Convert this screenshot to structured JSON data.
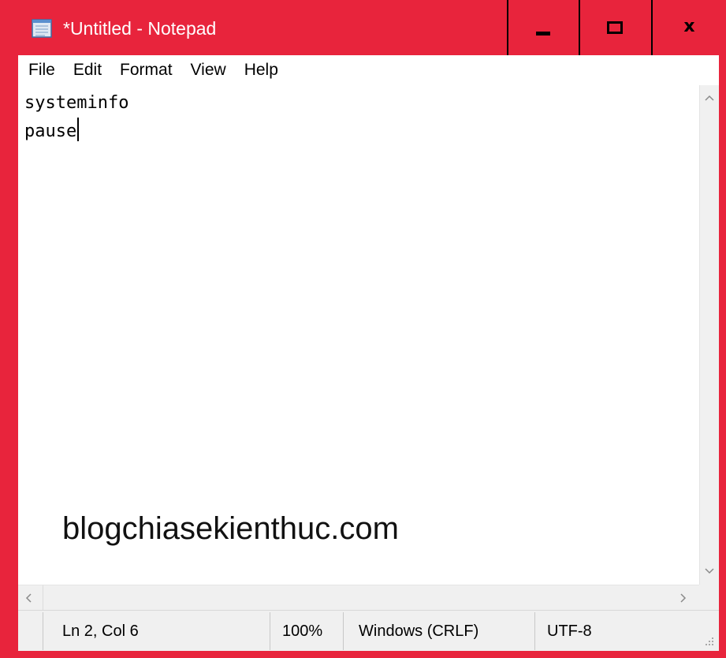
{
  "window": {
    "title": "*Untitled - Notepad",
    "frame_color": "#e8243c",
    "app_icon": "notepad-icon"
  },
  "titlebar_buttons": {
    "minimize": "minimize-icon",
    "maximize": "maximize-icon",
    "close_glyph": "x"
  },
  "menu": {
    "items": [
      "File",
      "Edit",
      "Format",
      "View",
      "Help"
    ]
  },
  "editor": {
    "lines": [
      "systeminfo",
      "pause"
    ],
    "caret": {
      "line": 2,
      "col": 6
    }
  },
  "watermark": "blogchiasekienthuc.com",
  "statusbar": {
    "position": "Ln 2, Col 6",
    "zoom": "100%",
    "line_ending": "Windows (CRLF)",
    "encoding": "UTF-8"
  }
}
